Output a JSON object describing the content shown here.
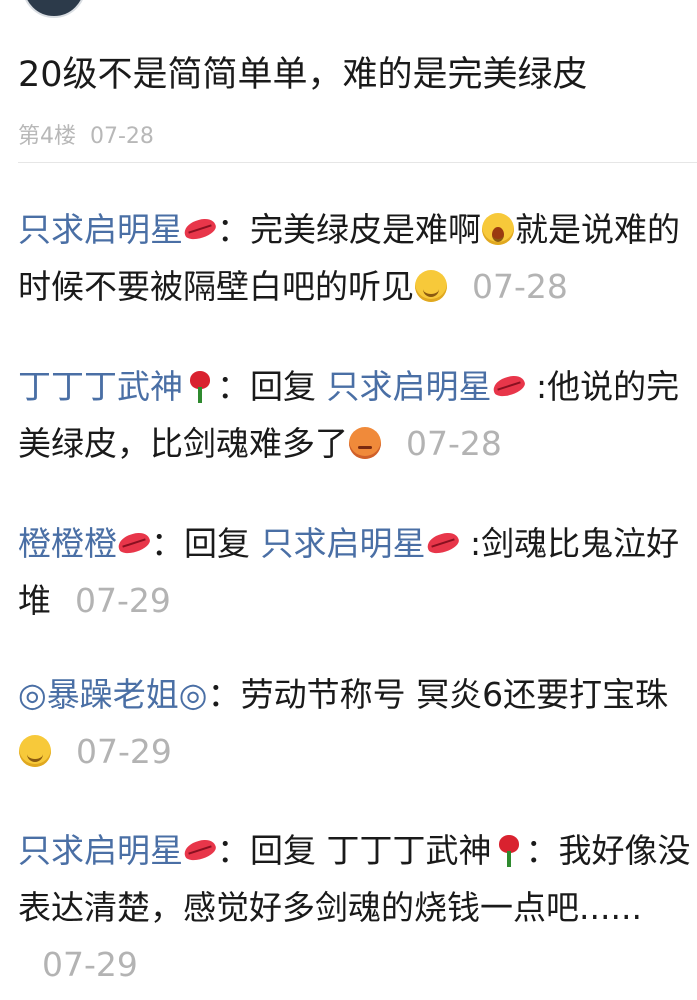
{
  "post": {
    "text": "20级不是简简单单，难的是完美绿皮",
    "floor": "第4楼",
    "date": "07-28"
  },
  "comments": [
    {
      "user": "只求启明星",
      "user_emoji": "lips-icon",
      "sep": "：",
      "body": "完美绿皮是难啊",
      "emoji1": "crying-face-icon",
      "body2": "就是说难的时候不要被隔壁白吧的听见",
      "emoji2": "smiling-face-icon",
      "time": "07-28"
    },
    {
      "user": "丁丁丁武神",
      "user_emoji": "rose-icon",
      "sep": "：",
      "reply_prefix": "回复",
      "reply_to": "只求启明星",
      "reply_to_emoji": "lips-icon",
      "body": ":他说的完美绿皮，比剑魂难多了",
      "emoji1": "angry-face-icon",
      "time": "07-28"
    },
    {
      "user": "橙橙橙",
      "user_emoji": "lips-icon",
      "sep": "：",
      "reply_prefix": "回复",
      "reply_to": "只求启明星",
      "reply_to_emoji": "lips-icon",
      "body": ":剑魂比鬼泣好堆",
      "time": "07-29"
    },
    {
      "user": "◎暴躁老姐◎",
      "sep": "：",
      "body": "劳动节称号 冥炎6还要打宝珠",
      "emoji1": "smiling-face-icon",
      "time": "07-29"
    },
    {
      "user": "只求启明星",
      "user_emoji": "lips-icon",
      "sep": "：",
      "reply_prefix": "回复",
      "reply_to": "丁丁丁武神",
      "reply_to_emoji": "rose-icon",
      "body": "：我好像没表达清楚，感觉好多剑魂的烧钱一点吧......",
      "time": "07-29"
    }
  ]
}
